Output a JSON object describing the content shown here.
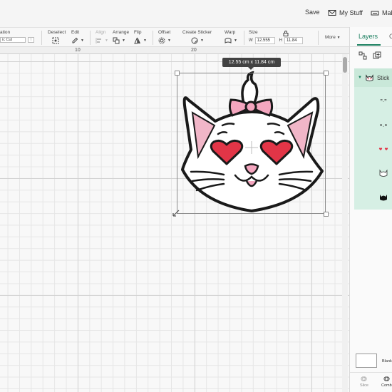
{
  "header": {
    "save_label": "Save",
    "mystuff_label": "My Stuff",
    "make_label": "Mak"
  },
  "toolbar": {
    "operation_label": "ation",
    "operation_value": "ic Cut",
    "deselect_label": "Deselect",
    "edit_label": "Edit",
    "align_label": "Align",
    "arrange_label": "Arrange",
    "flip_label": "Flip",
    "offset_label": "Offset",
    "create_sticker_label": "Create Sticker",
    "warp_label": "Warp",
    "size_label": "Size",
    "w_label": "W",
    "w_value": "12.555",
    "h_label": "H",
    "h_value": "11.84",
    "more_label": "More"
  },
  "ruler": {
    "marks": [
      "10",
      "20"
    ]
  },
  "canvas": {
    "dimension_badge": "12.55  cm x 11.84  cm"
  },
  "panel": {
    "tab_layers": "Layers",
    "tab_other": "C",
    "group_label": "Stick",
    "blank_label": "Blank",
    "slice_label": "Slice",
    "combine_label": "Comb"
  },
  "colors": {
    "accent": "#1b7f5f",
    "layer_bg": "#d6efe4",
    "heart": "#e23547",
    "bow": "#f4a6bf",
    "ear_inner": "#f1b6c8",
    "outline": "#1a1a1a"
  }
}
